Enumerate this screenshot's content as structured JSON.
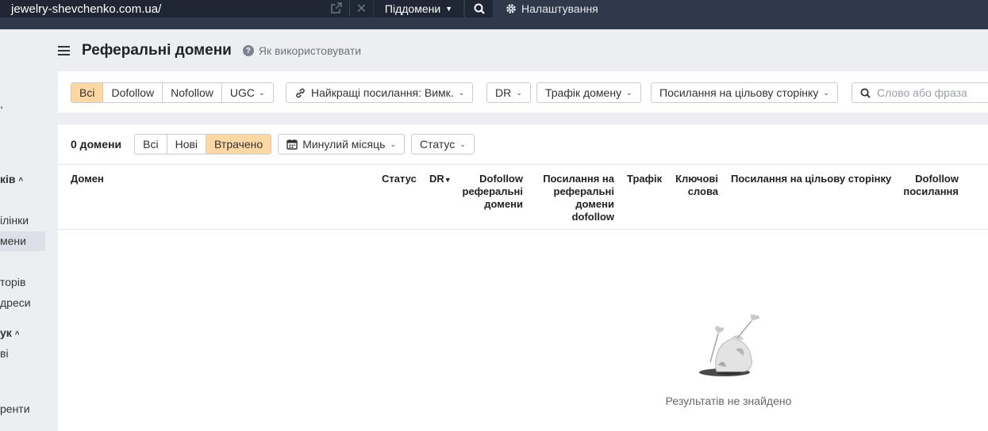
{
  "topbar": {
    "url": "jewelry-shevchenko.com.ua/",
    "subdomains_label": "Піддомени",
    "settings_label": "Налаштування"
  },
  "sidebar": {
    "items": [
      {
        "label": ","
      },
      {
        "label": "ків"
      },
      {
        "label": "ілінки"
      },
      {
        "label": "мени"
      },
      {
        "label": "торів"
      },
      {
        "label": "дреси"
      },
      {
        "label": "ук"
      },
      {
        "label": "ві"
      },
      {
        "label": "ренти"
      }
    ]
  },
  "header": {
    "title": "Реферальні домени",
    "howto": "Як використовувати"
  },
  "filters": {
    "link_types": [
      "Всі",
      "Dofollow",
      "Nofollow",
      "UGC"
    ],
    "best_links": "Найкращі посилання: Вимк.",
    "dr": "DR",
    "domain_traffic": "Трафік домену",
    "target_links": "Посилання на цільову сторінку",
    "search_placeholder": "Слово або фраза"
  },
  "results": {
    "count": "0 домени",
    "modes": [
      "Всі",
      "Нові",
      "Втрачено"
    ],
    "period": "Минулий місяць",
    "status": "Статус",
    "columns": {
      "domain": "Домен",
      "status": "Статус",
      "dr": "DR",
      "dofollow_ref_domains": "Dofollow реферальні домени",
      "links_to_ref_dofollow": "Посилання на реферальні домени dofollow",
      "traffic": "Трафік",
      "keywords": "Ключові слова",
      "links_to_target": "Посилання на цільову сторінку",
      "dofollow_links": "Dofollow посилання"
    },
    "empty_text": "Результатів не знайдено"
  }
}
